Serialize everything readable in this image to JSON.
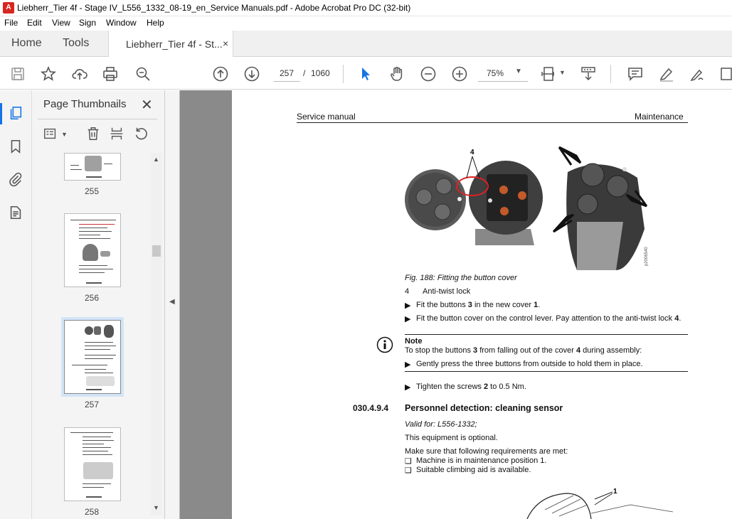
{
  "window": {
    "title": "Liebherr_Tier 4f - Stage IV_L556_1332_08-19_en_Service Manuals.pdf - Adobe Acrobat Pro DC (32-bit)"
  },
  "menu": [
    "File",
    "Edit",
    "View",
    "Sign",
    "Window",
    "Help"
  ],
  "tabs": {
    "home": "Home",
    "tools": "Tools",
    "document": "Liebherr_Tier 4f - St...",
    "close": "×"
  },
  "toolbar": {
    "current_page": "257",
    "separator": "/",
    "total_pages": "1060",
    "zoom": "75%"
  },
  "thumbnails_panel": {
    "title": "Page Thumbnails",
    "close": "✕",
    "pages": [
      {
        "label": "255",
        "selected": false
      },
      {
        "label": "256",
        "selected": false
      },
      {
        "label": "257",
        "selected": true
      },
      {
        "label": "258",
        "selected": false
      }
    ]
  },
  "document": {
    "header_left": "Service manual",
    "header_right": "Maintenance",
    "figure_callout_4": "4",
    "figure_code": "p2006540",
    "figure_caption": "Fig. 188: Fitting the button cover",
    "legend_num": "4",
    "legend_text": "Anti-twist lock",
    "step1_pre": "Fit the buttons ",
    "step1_b1": "3",
    "step1_mid": " in the new cover ",
    "step1_b2": "1",
    "step1_post": ".",
    "step2_pre": "Fit the button cover on the control lever. Pay attention to the anti-twist lock ",
    "step2_b": "4",
    "step2_post": ".",
    "note_title": "Note",
    "note_pre": "To stop the buttons ",
    "note_b1": "3",
    "note_mid": " from falling out of the cover ",
    "note_b2": "4",
    "note_post": " during assembly:",
    "note_step": "Gently press the three buttons from outside to hold them in place.",
    "step3_pre": "Tighten the screws ",
    "step3_b": "2",
    "step3_post": " to 0.5 Nm.",
    "section_num": "030.4.9.4",
    "section_title": "Personnel detection: cleaning sensor",
    "valid_for": "Valid for: L556-1332;",
    "optional": "This equipment is optional.",
    "requirements": "Make sure that following requirements are met:",
    "req1": "Machine is in maintenance position 1.",
    "req2": "Suitable climbing aid is available.",
    "figure2_callout": "1"
  }
}
